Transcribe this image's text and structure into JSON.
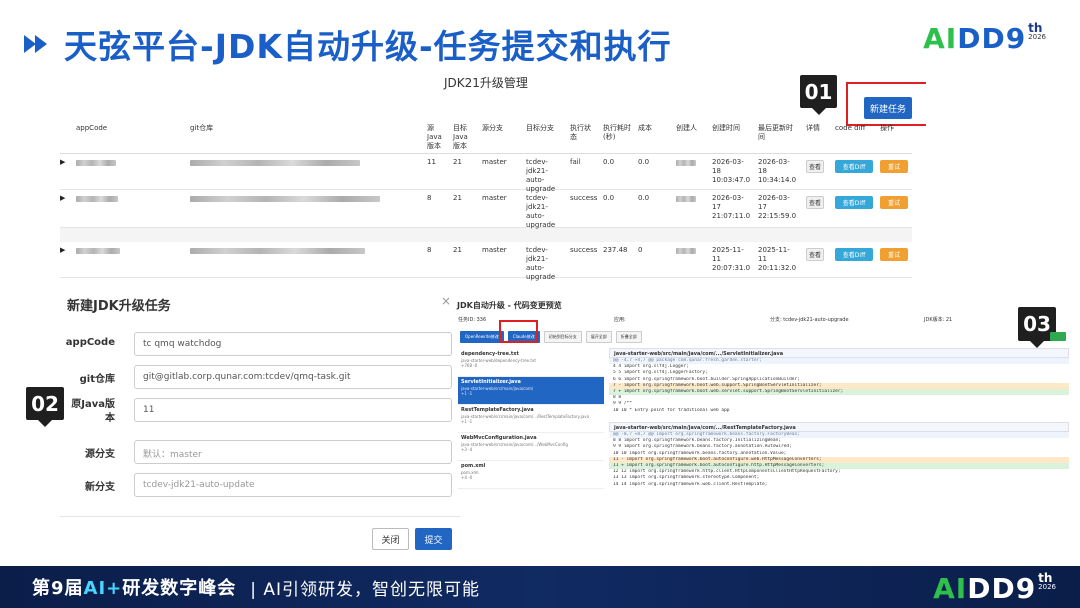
{
  "slide": {
    "title": "天弦平台-JDK自动升级-任务提交和执行",
    "logo_ai": "AI",
    "logo_dd": "DD",
    "logo_num": "9",
    "logo_sup": "th",
    "logo_year": "2026"
  },
  "badges": {
    "b1": "01",
    "b2": "02",
    "b3": "03"
  },
  "management": {
    "title": "JDK21升级管理",
    "new_task_button": "新建任务",
    "columns": [
      "appCode",
      "git仓库",
      "源Java版本",
      "目标Java版本",
      "源分支",
      "目标分支",
      "执行状态",
      "执行耗时(秒)",
      "成本",
      "创建人",
      "创建时间",
      "最后更新时间",
      "详情",
      "code diff",
      "操作"
    ],
    "column_labels": {
      "appcode": "appCode",
      "git": "git仓库",
      "src_java": "源 Java 版本",
      "tgt_java": "目标 Java 版本",
      "src_branch": "源分支",
      "tgt_branch": "目标分支",
      "status": "执行状 态",
      "duration": "执行耗时 (秒)",
      "cost": "成本",
      "creator": "创建人",
      "created": "创建时间",
      "updated": "最后更新时 间",
      "detail": "详情",
      "diff": "code diff",
      "op": "操作"
    },
    "rows": [
      {
        "src_java": "11",
        "tgt_java": "21",
        "src_branch": "master",
        "tgt_branch": "tcdev-jdk21-auto-upgrade",
        "status": "fail",
        "duration": "0.0",
        "cost": "0.0",
        "created": "2026-03-18 10:03:47.0",
        "updated": "2026-03-18 10:34:14.0",
        "view": "查看",
        "diff": "查看Diff",
        "redo": "重试"
      },
      {
        "src_java": "8",
        "tgt_java": "21",
        "src_branch": "master",
        "tgt_branch": "tcdev-jdk21-auto-upgrade",
        "status": "success",
        "duration": "0.0",
        "cost": "0.0",
        "created": "2026-03-17 21:07:11.0",
        "updated": "2026-03-17 22:15:59.0",
        "view": "查看",
        "diff": "查看Diff",
        "redo": "重试"
      },
      {
        "src_java": "8",
        "tgt_java": "21",
        "src_branch": "master",
        "tgt_branch": "tcdev-jdk21-auto-upgrade",
        "status": "success",
        "duration": "237.48",
        "cost": "0",
        "created": "2025-11-11 20:07:31.0",
        "updated": "2025-11-11 20:11:32.0",
        "view": "查看",
        "diff": "查看Diff",
        "redo": "重试"
      }
    ]
  },
  "modal": {
    "title": "新建JDK升级任务",
    "close_symbol": "×",
    "fields": {
      "appcode_label": "appCode",
      "appcode_value": "tc qmq watchdog",
      "git_label": "git仓库",
      "git_value": "git@gitlab.corp.qunar.com:tcdev/qmq-task.git",
      "java_label": "原Java版本",
      "java_value": "11",
      "src_label": "源分支",
      "src_placeholder": "默认：master",
      "new_label": "新分支",
      "new_placeholder": "tcdev-jdk21-auto-update"
    },
    "close_button": "关闭",
    "submit_button": "提交"
  },
  "preview": {
    "title": "JDK自动升级 - 代码变更预览",
    "task_id": "任务ID: 336",
    "app": "应用:",
    "branch": "分支: tcdev-jdk21-auto-upgrade",
    "jdk": "JDK版本: 21",
    "tabs": [
      "OpenRewrite修改",
      "Claude修改",
      "初始到目标分支",
      "展开全部",
      "折叠全部"
    ],
    "files": [
      {
        "name": "dependency-tree.txt",
        "path": "java-starter-web/dependency-tree.txt",
        "stat": "+768 -0"
      },
      {
        "name": "ServletInitializer.java",
        "path": "java-starter-web/src/main/java/com/",
        "stat": "+1 -1"
      },
      {
        "name": "RestTemplateFactory.java",
        "path": "java-starter-web/src/main/java/com/.../RestTemplateFactory.java",
        "stat": "+1 -1"
      },
      {
        "name": "WebMvcConfiguration.java",
        "path": "java-starter-web/src/main/java/com/.../WebMvcConfig",
        "stat": "+3 -4"
      },
      {
        "name": "pom.xml",
        "path": "pom.xml",
        "stat": "+4 -0"
      }
    ],
    "diff1_header": "java-starter-web/src/main/java/com/.../ServletInitializer.java",
    "diff1_lines": [
      "@@ -4,7 +4,7 @@ package com.qunar.fresh.garden.starter;",
      "4    4    import org.slf4j.Logger;",
      "5    5    import org.slf4j.LoggerFactory;",
      "6    6    import org.springframework.boot.builder.SpringApplicationBuilder;",
      "7       - import org.springframework.boot.web.support.SpringBootServletInitializer;",
      "     7  + import org.springframework.boot.web.servlet.support.SpringBootServletInitializer;",
      "8    8",
      "9    9    /**",
      "10  10     * Entry point for traditional web app"
    ],
    "diff2_header": "java-starter-web/src/main/java/com/.../RestTemplateFactory.java",
    "diff2_lines": [
      "@@ -8,7 +8,7 @@ import org.springframework.beans.factory.FactoryBean;",
      "8    8    import org.springframework.beans.factory.InitializingBean;",
      "9    9    import org.springframework.beans.factory.annotation.Autowired;",
      "10  10    import org.springframework.beans.factory.annotation.Value;",
      "11      - import org.springframework.boot.autoconfigure.web.HttpMessageConverters;",
      "    11  + import org.springframework.boot.autoconfigure.http.HttpMessageConverters;",
      "12  12    import org.springframework.http.client.HttpComponentsClientHttpRequestFactory;",
      "13  13    import org.springframework.stereotype.Component;",
      "14  14    import org.springframework.web.client.RestTemplate;"
    ]
  },
  "footer": {
    "event": "第9届",
    "accent": "AI+",
    "event_rest": "研发数字峰会",
    "slogan": "|  AI引领研发，智创无限可能"
  }
}
